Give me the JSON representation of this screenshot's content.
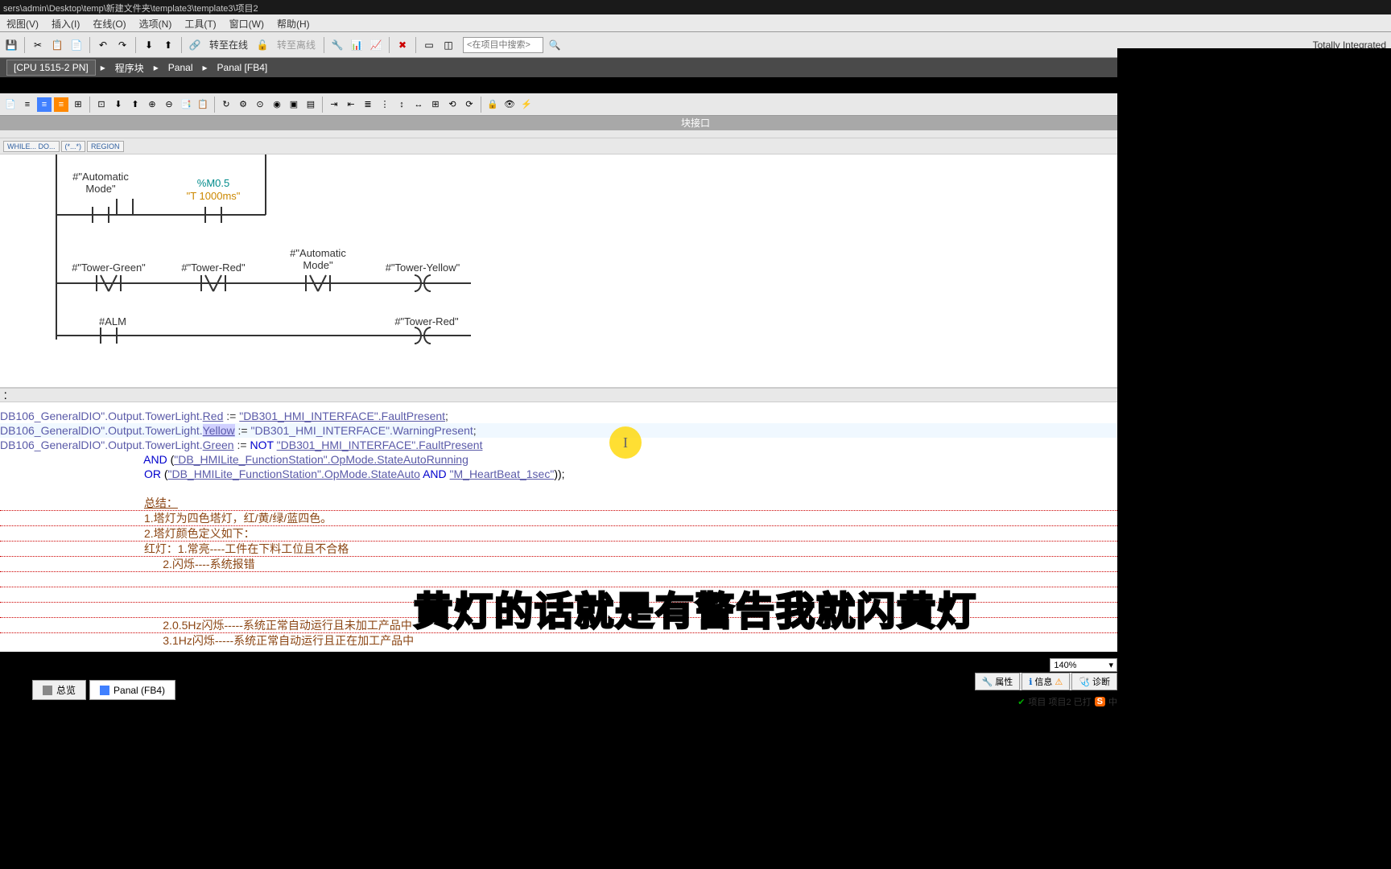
{
  "titlebar": "sers\\admin\\Desktop\\temp\\新建文件夹\\template3\\template3\\项目2",
  "menu": [
    "视图(V)",
    "插入(I)",
    "在线(O)",
    "选项(N)",
    "工具(T)",
    "窗口(W)",
    "帮助(H)"
  ],
  "toolbar": {
    "go_online": "转至在线",
    "go_offline": "转至离线",
    "search_placeholder": "<在项目中搜索>"
  },
  "brand": "Totally Integrated",
  "breadcrumb": {
    "cpu": "[CPU 1515-2 PN]",
    "items": [
      "程序块",
      "Panal",
      "Panal [FB4]"
    ]
  },
  "interface_title": "块接口",
  "code_tabs": {
    "while_do": "WHILE... DO...",
    "comment": "(*...*)",
    "region": "REGION"
  },
  "ladder": {
    "auto_mode": "#\"Automatic Mode\"",
    "m05": "%M0.5",
    "t1000": "\"T 1000ms\"",
    "tower_green": "#\"Tower-Green\"",
    "tower_red": "#\"Tower-Red\"",
    "tower_yellow": "#\"Tower-Yellow\"",
    "alm": "#ALM",
    "tower_red2": "#\"Tower-Red\""
  },
  "scl": {
    "l1_tag": "DB106_GeneralDIO\".Output.TowerLight.",
    "l1_red": "Red",
    "l1_assign": ":=",
    "l1_val": "\"DB301_HMI_INTERFACE\".FaultPresent",
    "l2_tag": "DB106_GeneralDIO\".Output.TowerLight.",
    "l2_yellow": "Yellow",
    "l2_val": "\"DB301_HMI_INTERFACE\".WarningPresent",
    "l3_tag": "DB106_GeneralDIO\".Output.TowerLight.",
    "l3_green": "Green",
    "l3_not": "NOT",
    "l3_val": "\"DB301_HMI_INTERFACE\".FaultPresent",
    "l4_and": "AND",
    "l4_val": "\"DB_HMILite_FunctionStation\".OpMode.StateAutoRunning",
    "l5_or": "OR",
    "l5_val1": "\"DB_HMILite_FunctionStation\".OpMode.StateAuto",
    "l5_and": "AND",
    "l5_val2": "\"M_HeartBeat_1sec\"",
    "summary": "总结：",
    "c1": "1.塔灯为四色塔灯，红/黄/绿/蓝四色。",
    "c2": "2.塔灯颜色定义如下：",
    "c3": "红灯：1.常亮----工件在下料工位且不合格",
    "c4": "      2.闪烁----系统报错",
    "c5": "      2.0.5Hz闪烁-----系统正常自动运行且未加工产品中",
    "c6": "      3.1Hz闪烁-----系统正常自动运行且正在加工产品中"
  },
  "zoom": "140%",
  "status_tabs": {
    "props": "属性",
    "info": "信息",
    "diag": "诊断"
  },
  "bottom_tabs": {
    "overview": "总览",
    "panal": "Panal (FB4)"
  },
  "status_strip": {
    "project": "项目 项目2 已打",
    "ime": "S",
    "lang": "中"
  },
  "subtitle": "黄灯的话就是有警告我就闪黄灯"
}
